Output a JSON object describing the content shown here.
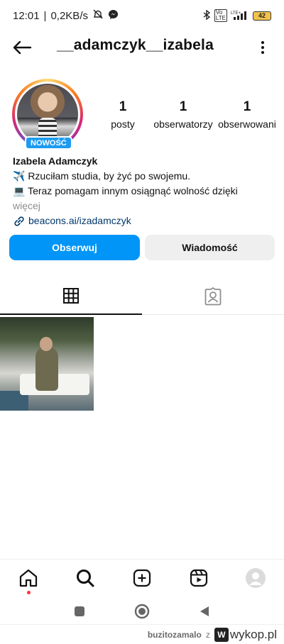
{
  "status_bar": {
    "time": "12:01",
    "network_speed": "0,2KB/s",
    "lte_label": "LTE+",
    "battery_level": "42",
    "icons": [
      "mute-icon",
      "messenger-icon",
      "bluetooth-icon",
      "volte-icon",
      "signal-icon",
      "battery-icon"
    ]
  },
  "header": {
    "username": "__adamczyk__izabela",
    "back_icon": "arrow-left-icon",
    "more_icon": "more-vertical-icon"
  },
  "profile": {
    "new_badge": "NOWOŚĆ",
    "stats": [
      {
        "value": "1",
        "label": "posty"
      },
      {
        "value": "1",
        "label": "obserwatorzy"
      },
      {
        "value": "1",
        "label": "obserwowani"
      }
    ],
    "name": "Izabela Adamczyk",
    "bio_lines": [
      "✈️ Rzuciłam studia, by żyć po swojemu.",
      "💻 Teraz pomagam innym osiągnąć wolność dzięki"
    ],
    "more_label": "więcej",
    "link": "beacons.ai/izadamczyk"
  },
  "buttons": {
    "follow": "Obserwuj",
    "message": "Wiadomość"
  },
  "tabs": [
    {
      "icon": "grid-icon",
      "active": true
    },
    {
      "icon": "tagged-person-icon",
      "active": false
    }
  ],
  "bottom_nav": [
    "home-icon",
    "search-icon",
    "create-icon",
    "reels-icon",
    "profile-avatar-icon"
  ],
  "system_nav": [
    "recent-apps-icon",
    "home-circle-icon",
    "back-triangle-icon"
  ],
  "watermark": {
    "user": "buzitozamalo",
    "separator": "z",
    "site": "wykop.pl",
    "logo_letter": "W"
  },
  "colors": {
    "accent": "#0095f6",
    "badge": "#1c9bf0",
    "link": "#00376b",
    "notification_dot": "#ff3040"
  }
}
